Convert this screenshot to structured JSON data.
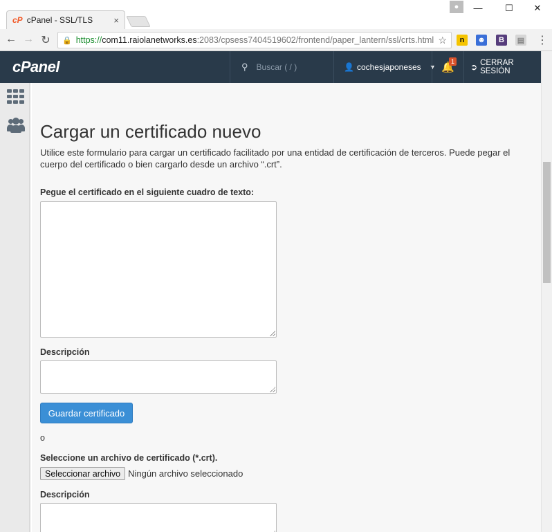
{
  "browser": {
    "tab_title": "cPanel - SSL/TLS",
    "tab_favicon": "cP",
    "tab_close": "×",
    "url_secure": "https://",
    "url_host": "com11.raiolanetworks.es",
    "url_path": ":2083/cpsess7404519602/frontend/paper_lantern/ssl/crts.html",
    "window_controls": {
      "minimize": "—",
      "maximize": "☐",
      "close": "✕"
    },
    "nav": {
      "back": "←",
      "forward": "→",
      "reload": "↻"
    },
    "extensions": [
      {
        "icon": "n-extension-icon",
        "glyph": "n",
        "color": "#f5c400"
      },
      {
        "icon": "robot-extension-icon",
        "glyph": "☻",
        "color": "#3a6fd8"
      },
      {
        "icon": "b-extension-icon",
        "glyph": "B",
        "color": "#563d7c"
      },
      {
        "icon": "doc-extension-icon",
        "glyph": "▤",
        "color": "#bdbdbd"
      }
    ]
  },
  "header": {
    "logo": "cPanel",
    "search_placeholder": "Buscar ( / )",
    "username": "cochesjaponeses",
    "notifications_count": "1",
    "logout_label": "CERRAR SESIÓN"
  },
  "main": {
    "title": "Cargar un certificado nuevo",
    "description": "Utilice este formulario para cargar un certificado facilitado por una entidad de certificación de terceros. Puede pegar el cuerpo del certificado o bien cargarlo desde un archivo “.crt”.",
    "paste_label": "Pegue el certificado en el siguiente cuadro de texto:",
    "description_label_1": "Descripción",
    "save_button": "Guardar certificado",
    "or_text": "o",
    "file_label": "Seleccione un archivo de certificado (*.crt).",
    "file_button": "Seleccionar archivo",
    "file_status": "Ningún archivo seleccionado",
    "description_label_2": "Descripción"
  },
  "colors": {
    "header_bg": "#293a4a",
    "primary_button": "#3b8fd6",
    "badge": "#d9532c"
  }
}
